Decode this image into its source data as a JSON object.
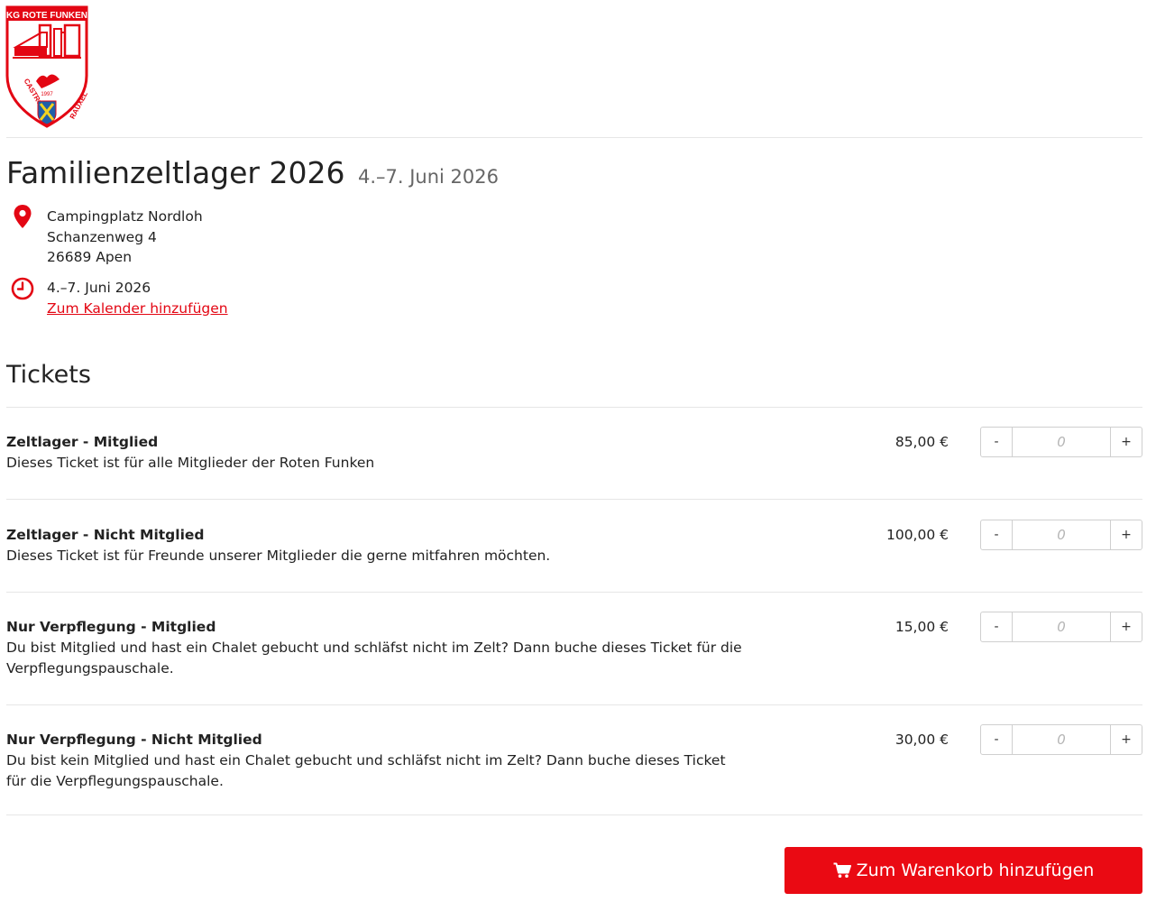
{
  "header": {
    "logo": {
      "top_text": "KG ROTE FUNKEN",
      "year": "1997",
      "left_text": "CASTROP",
      "right_text": "RAUXEL"
    }
  },
  "event": {
    "title": "Familienzeltlager 2026",
    "date_range": "4.–7. Juni 2026",
    "location": {
      "name": "Campingplatz Nordloh",
      "street": "Schanzenweg 4",
      "city": "26689 Apen"
    },
    "date_label": "4.–7. Juni 2026",
    "calendar_link": "Zum Kalender hinzufügen"
  },
  "tickets": {
    "heading": "Tickets",
    "items": [
      {
        "name": "Zeltlager - Mitglied",
        "description": "Dieses Ticket ist für alle Mitglieder der Roten Funken",
        "price": "85,00 €",
        "quantity_placeholder": "0",
        "minus": "-",
        "plus": "+"
      },
      {
        "name": "Zeltlager - Nicht Mitglied",
        "description": "Dieses Ticket ist für Freunde unserer Mitglieder die gerne mitfahren möchten.",
        "price": "100,00 €",
        "quantity_placeholder": "0",
        "minus": "-",
        "plus": "+"
      },
      {
        "name": "Nur Verpflegung - Mitglied",
        "description": "Du bist Mitglied und hast ein Chalet gebucht und schläfst nicht im Zelt? Dann buche dieses Ticket für die Verpflegungspauschale.",
        "price": "15,00 €",
        "quantity_placeholder": "0",
        "minus": "-",
        "plus": "+"
      },
      {
        "name": "Nur Verpflegung - Nicht Mitglied",
        "description": "Du bist kein Mitglied und hast ein Chalet gebucht und schläfst nicht im Zelt? Dann buche dieses Ticket für die Verpflegungspauschale.",
        "price": "30,00 €",
        "quantity_placeholder": "0",
        "minus": "-",
        "plus": "+"
      }
    ]
  },
  "cart": {
    "button_label": "Zum Warenkorb hinzufügen",
    "icon": "shopping-cart-icon"
  },
  "colors": {
    "accent": "#e30613",
    "button": "#ea0a13",
    "logo_blue": "#1f5fa8",
    "logo_yellow": "#f2d21f"
  },
  "icons": {
    "location": "map-marker-icon",
    "time": "clock-icon"
  }
}
